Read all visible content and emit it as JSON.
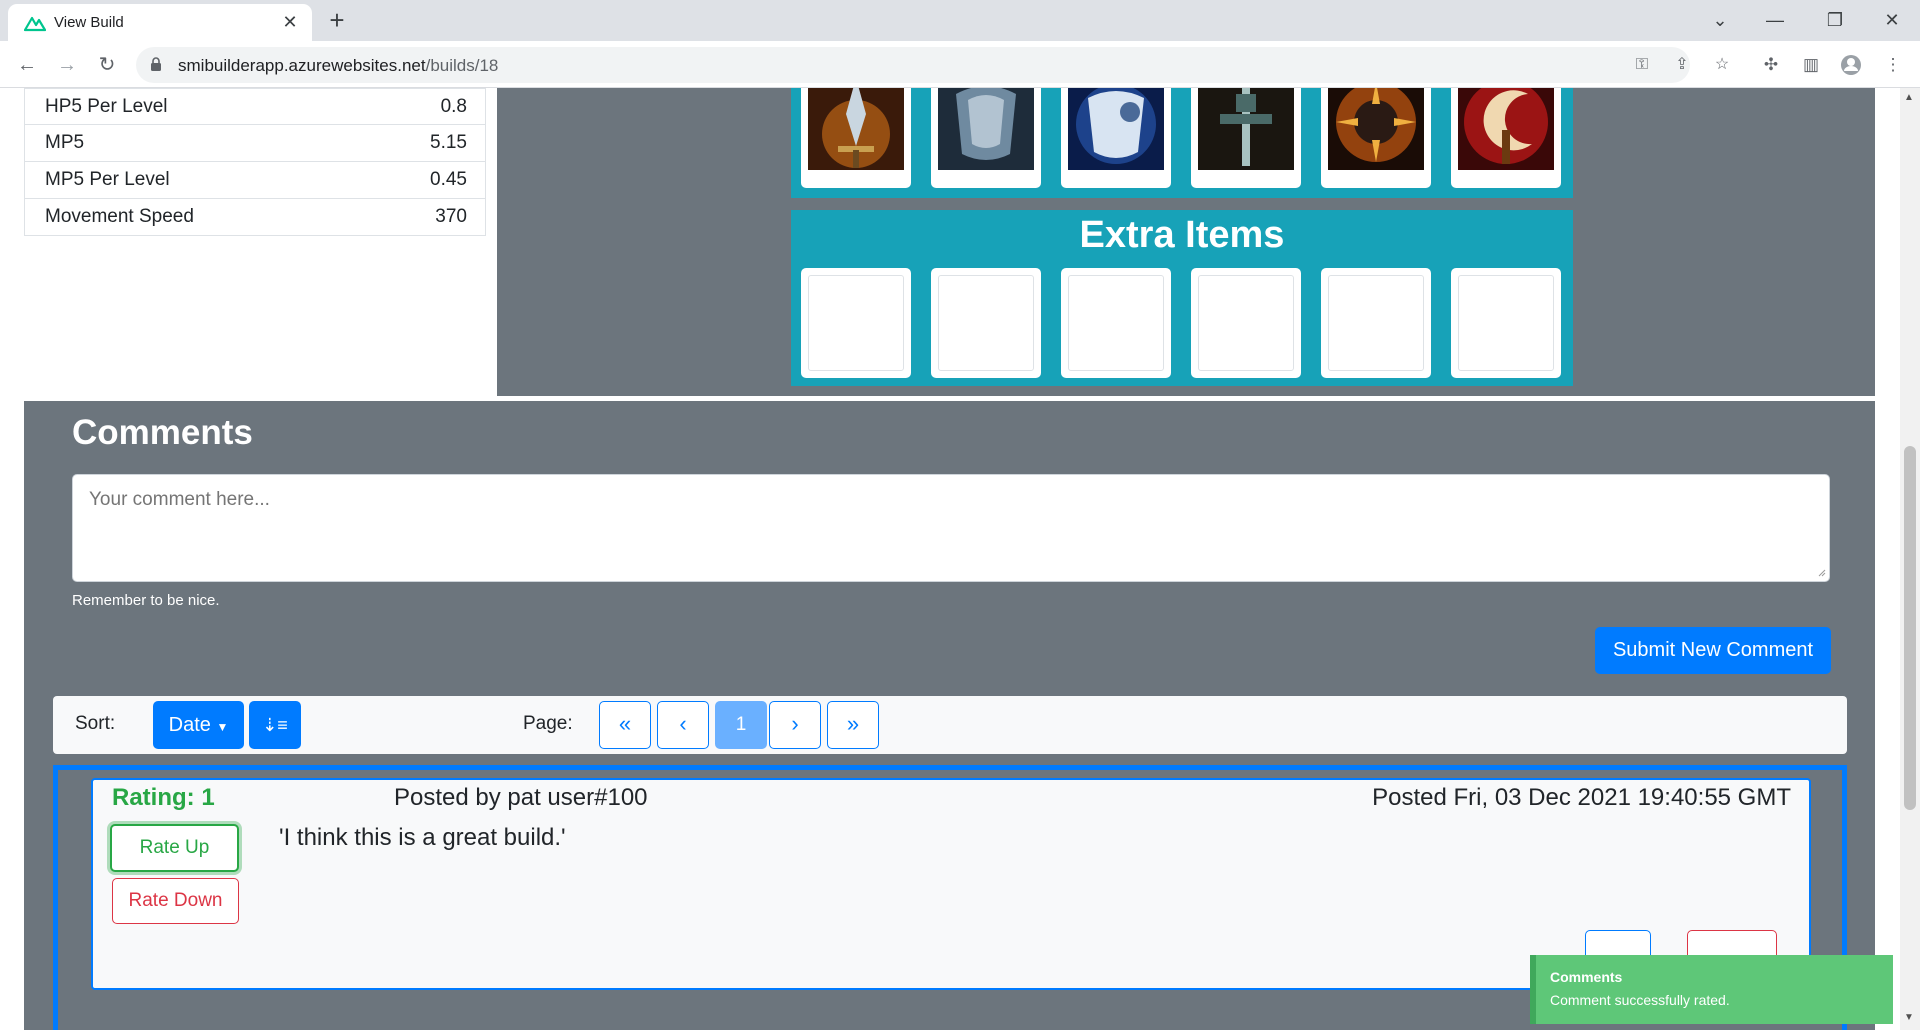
{
  "browser": {
    "tab_title": "View Build",
    "url_host": "smibuilderapp.azurewebsites.net",
    "url_path": "/builds/18"
  },
  "stats": [
    {
      "name": "HP5 Per Level",
      "value": "0.8"
    },
    {
      "name": "MP5",
      "value": "5.15"
    },
    {
      "name": "MP5 Per Level",
      "value": "0.45"
    },
    {
      "name": "Movement Speed",
      "value": "370"
    }
  ],
  "build": {
    "items": [
      {
        "icon": "spear-item-icon",
        "colors": [
          "#3a1a0a",
          "#e07a1a",
          "#c9d6e0"
        ]
      },
      {
        "icon": "breastplate-item-icon",
        "colors": [
          "#1e2c3a",
          "#6f8aa0",
          "#cfdbe6"
        ]
      },
      {
        "icon": "armor-item-icon",
        "colors": [
          "#0a1c4a",
          "#2a5bb8",
          "#d8e4f2"
        ]
      },
      {
        "icon": "mace-item-icon",
        "colors": [
          "#1a1610",
          "#4a6a68",
          "#a8c2c0"
        ]
      },
      {
        "icon": "spiked-ball-item-icon",
        "colors": [
          "#1a0c06",
          "#c85a12",
          "#f0b040"
        ]
      },
      {
        "icon": "hook-blade-item-icon",
        "colors": [
          "#3a0808",
          "#c41a1a",
          "#f0d8b0"
        ]
      }
    ],
    "extra_items_title": "Extra Items",
    "extra_slots": 6
  },
  "comments": {
    "title": "Comments",
    "placeholder": "Your comment here...",
    "hint": "Remember to be nice.",
    "submit_label": "Submit New Comment",
    "sort_label": "Sort:",
    "sort_value": "Date",
    "page_label": "Page:",
    "pagination": [
      "«",
      "‹",
      "1",
      "›",
      "»"
    ],
    "current_page": "1",
    "list": [
      {
        "rating": "Rating: 1",
        "author": "Posted by pat user#100",
        "date": "Posted Fri, 03 Dec 2021 19:40:55 GMT",
        "text": "'I think this is a great build.'",
        "rate_up_label": "Rate Up",
        "rate_down_label": "Rate Down"
      }
    ]
  },
  "toast": {
    "title": "Comments",
    "message": "Comment successfully rated."
  },
  "colors": {
    "primary": "#007bff",
    "success": "#28a745",
    "danger": "#dc3545",
    "panel": "#6c757d",
    "info": "#17a2b8"
  }
}
